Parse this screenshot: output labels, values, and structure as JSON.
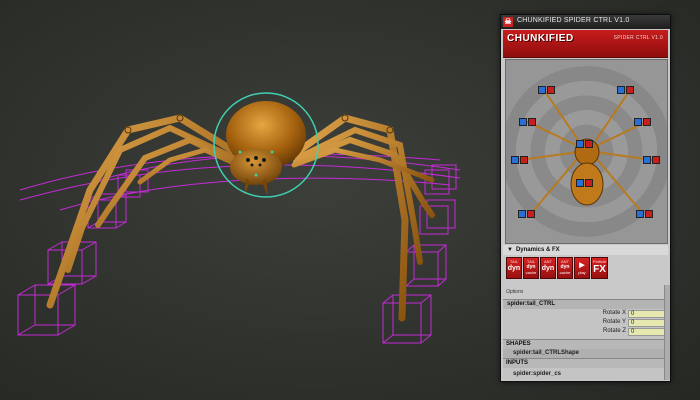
{
  "window": {
    "title": "CHUNKIFIED SPIDER CTRL V1.0",
    "logo_glyph": "☠"
  },
  "banner": {
    "brand": "CHUNKIFIED",
    "subtitle": "SPIDER CTRL V1.0"
  },
  "dynamics": {
    "header": "Dynamics & FX",
    "arrow": "▼",
    "buttons": [
      {
        "top": "TAIL",
        "main": "dyn",
        "bottom": ""
      },
      {
        "top": "TAIL",
        "main": "dyn",
        "bottom": "cache"
      },
      {
        "top": "ANT",
        "main": "dyn",
        "bottom": ""
      },
      {
        "top": "ANT",
        "main": "dyn",
        "bottom": "cache"
      },
      {
        "top": "",
        "main": "▶",
        "bottom": "play"
      },
      {
        "top": "Particle",
        "main": "FX",
        "bottom": ""
      }
    ]
  },
  "attributes": {
    "options_label": "Options",
    "node_name": "spider:tail_CTRL",
    "rows": [
      {
        "label": "Rotate X",
        "value": "0"
      },
      {
        "label": "Rotate Y",
        "value": "0"
      },
      {
        "label": "Rotate Z",
        "value": "0"
      }
    ],
    "shapes_header": "SHAPES",
    "shape_node": "spider:tail_CTRLShape",
    "inputs_header": "INPUTS",
    "input_node": "spider:spider_cs"
  },
  "colors": {
    "accent_red": "#c81c1c",
    "control_blue": "#2a6fd6",
    "viewport_wire": "#c52bd6",
    "selection_circle": "#3fd0b0",
    "spider_body": "#b06a12"
  },
  "icons": {
    "logo": "spider-logo-icon",
    "picker_buttons": "ik-fk-toggle-icon"
  }
}
